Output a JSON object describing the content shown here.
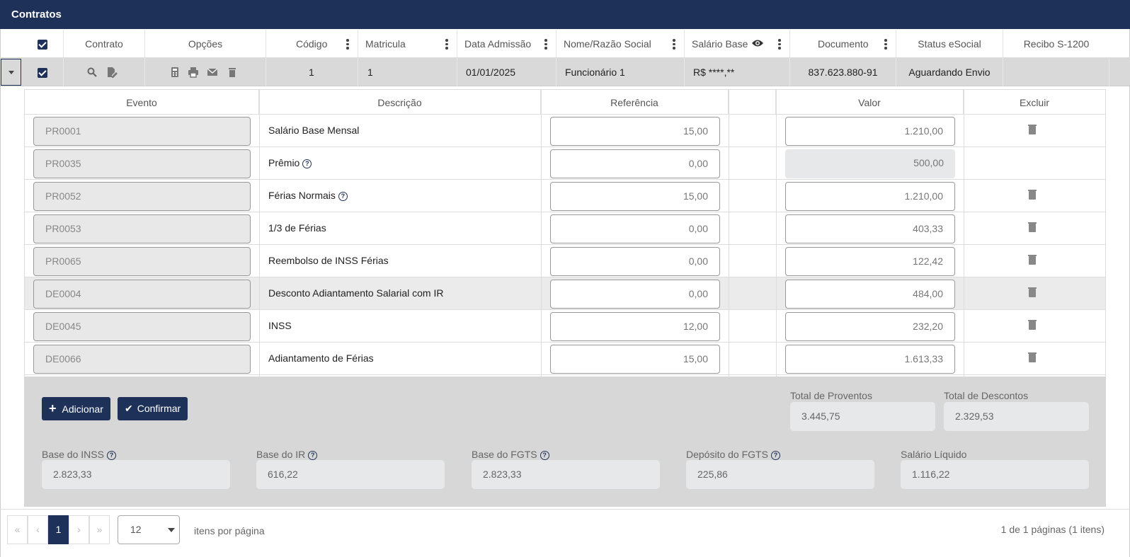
{
  "title": "Contratos",
  "columns": {
    "contrato": "Contrato",
    "opcoes": "Opções",
    "codigo": "Código",
    "matricula": "Matricula",
    "data_admissao": "Data Admissão",
    "nome": "Nome/Razão Social",
    "salario": "Salário Base",
    "documento": "Documento",
    "status": "Status eSocial",
    "recibo": "Recibo S-1200"
  },
  "row": {
    "codigo": "1",
    "matricula": "1",
    "data_admissao": "01/01/2025",
    "nome": "Funcionário 1",
    "salario": "R$ ****,**",
    "documento": "837.623.880-91",
    "status": "Aguardando Envio",
    "recibo": ""
  },
  "events_header": {
    "evento": "Evento",
    "descricao": "Descrição",
    "referencia": "Referência",
    "valor": "Valor",
    "excluir": "Excluir"
  },
  "events": [
    {
      "code": "PR0001",
      "desc": "Salário Base Mensal",
      "ref": "15,00",
      "valor": "1.210,00",
      "help": false,
      "readonly": false,
      "delete": true
    },
    {
      "code": "PR0035",
      "desc": "Prêmio",
      "ref": "0,00",
      "valor": "500,00",
      "help": true,
      "readonly": true,
      "delete": false
    },
    {
      "code": "PR0052",
      "desc": "Férias Normais",
      "ref": "15,00",
      "valor": "1.210,00",
      "help": true,
      "readonly": false,
      "delete": true
    },
    {
      "code": "PR0053",
      "desc": "1/3 de Férias",
      "ref": "0,00",
      "valor": "403,33",
      "help": false,
      "readonly": false,
      "delete": true
    },
    {
      "code": "PR0065",
      "desc": "Reembolso de INSS Férias",
      "ref": "0,00",
      "valor": "122,42",
      "help": false,
      "readonly": false,
      "delete": true
    },
    {
      "code": "DE0004",
      "desc": "Desconto Adiantamento Salarial com IR",
      "ref": "0,00",
      "valor": "484,00",
      "help": false,
      "readonly": false,
      "delete": true
    },
    {
      "code": "DE0045",
      "desc": "INSS",
      "ref": "12,00",
      "valor": "232,20",
      "help": false,
      "readonly": false,
      "delete": true
    },
    {
      "code": "DE0066",
      "desc": "Adiantamento de Férias",
      "ref": "15,00",
      "valor": "1.613,33",
      "help": false,
      "readonly": false,
      "delete": true
    }
  ],
  "buttons": {
    "adicionar": "Adicionar",
    "confirmar": "Confirmar"
  },
  "totals": {
    "proventos_label": "Total de Proventos",
    "proventos": "3.445,75",
    "descontos_label": "Total de Descontos",
    "descontos": "2.329,53"
  },
  "bases": {
    "inss_label": "Base do INSS",
    "inss": "2.823,33",
    "ir_label": "Base do IR",
    "ir": "616,22",
    "fgts_label": "Base do FGTS",
    "fgts": "2.823,33",
    "deposito_label": "Depósito do FGTS",
    "deposito": "225,86",
    "liquido_label": "Salário Líquido",
    "liquido": "1.116,22"
  },
  "pagination": {
    "first": "«",
    "prev": "‹",
    "page": "1",
    "next": "›",
    "last": "»",
    "page_size": "12",
    "per_page_label": "itens por página",
    "summary": "1 de 1 páginas (1 itens)"
  },
  "colors": {
    "primary": "#1e3259"
  }
}
